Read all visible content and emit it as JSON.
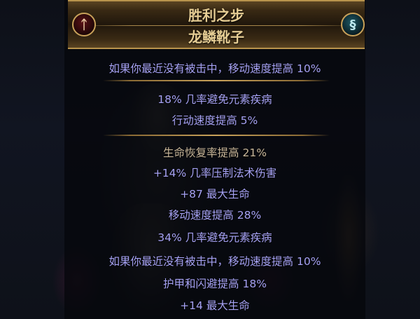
{
  "item": {
    "name": "胜利之步",
    "base_type": "龙鳞靴子",
    "emblem_left_icon": "left-influence-emblem-icon",
    "emblem_right_icon": "right-influence-emblem-icon",
    "enchant": "如果你最近没有被击中，移动速度提高 10%",
    "implicit_mods": [
      "18% 几率避免元素疾病",
      "行动速度提高 5%"
    ],
    "explicit_mods": [
      "生命恢复率提高 21%",
      "+14% 几率压制法术伤害",
      "+87 最大生命",
      "移动速度提高 28%",
      "34% 几率避免元素疾病",
      "如果你最近没有被击中，移动速度提高 10%",
      "护甲和闪避提高 18%",
      "+14 最大生命"
    ]
  },
  "colors": {
    "title": "#e6cd94",
    "magic_mod": "#a6a2f4",
    "separator": "#c9a25a"
  }
}
